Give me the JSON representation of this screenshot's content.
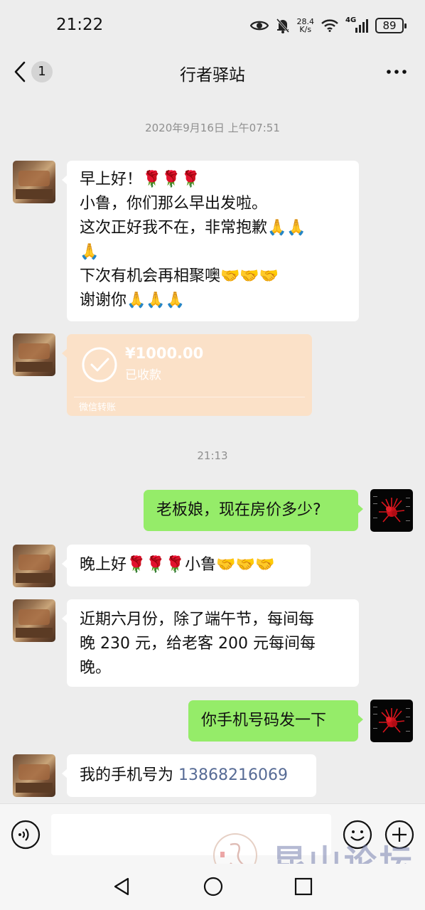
{
  "status_bar": {
    "time": "21:22",
    "speed_value": "28.4",
    "speed_unit": "K/s",
    "network": "4G",
    "battery": "89"
  },
  "header": {
    "unread_count": "1",
    "title": "行者驿站"
  },
  "messages": {
    "ts1": "2020年9月16日 上午07:51",
    "m1": {
      "l1": "早上好！🌹🌹🌹",
      "l2": "小鲁，你们那么早出发啦。",
      "l3": "这次正好我不在，非常抱歉🙏🙏",
      "l4": "🙏",
      "l5": "下次有机会再相聚噢🤝🤝🤝",
      "l6": "谢谢你🙏🙏🙏"
    },
    "transfer": {
      "amount": "¥1000.00",
      "status": "已收款",
      "label": "微信转账"
    },
    "ts2": "21:13",
    "m2": "老板娘，现在房价多少?",
    "m3": "晚上好🌹🌹🌹小鲁🤝🤝🤝",
    "m4": {
      "l1": "近期六月份，除了端午节，每间每",
      "l2": "晚 230 元，给老客 200 元每间每",
      "l3": "晚。"
    },
    "m5": "你手机号码发一下",
    "m6": {
      "prefix": "我的手机号为 ",
      "phone": "13868216069"
    }
  },
  "input": {
    "value": ""
  },
  "watermark": {
    "text": "昆山论坛"
  },
  "icons": {
    "back": "chevron-left-icon",
    "more": "more-icon",
    "voice": "voice-icon",
    "emoji": "emoji-icon",
    "add": "plus-icon",
    "transfer": "check-circle-icon"
  },
  "colors": {
    "background": "#ededed",
    "bubble_self": "#95ec69",
    "bubble_other": "#ffffff",
    "transfer": "#fbe1c8",
    "link": "#576b95"
  }
}
